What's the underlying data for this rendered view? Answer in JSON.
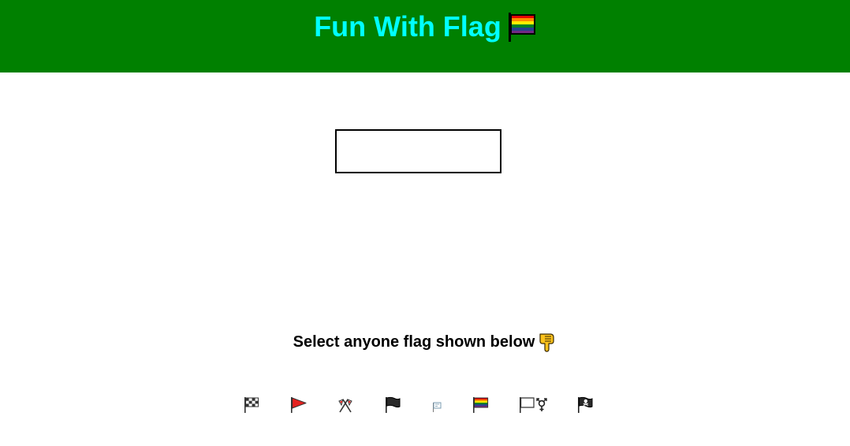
{
  "header": {
    "title": "Fun With Flag",
    "title_icon": "rainbow-flag-icon",
    "background_color": "#008000",
    "title_color": "#00ffff"
  },
  "display": {
    "value": ""
  },
  "prompt": {
    "text": "Select anyone flag shown below",
    "icon": "pointing-down-hand-icon"
  },
  "flags": [
    {
      "name": "chequered-flag-icon"
    },
    {
      "name": "triangular-flag-icon"
    },
    {
      "name": "crossed-flags-icon"
    },
    {
      "name": "black-flag-icon"
    },
    {
      "name": "white-flag-icon"
    },
    {
      "name": "rainbow-flag-icon"
    },
    {
      "name": "transgender-flag-icon"
    },
    {
      "name": "pirate-flag-icon"
    }
  ]
}
